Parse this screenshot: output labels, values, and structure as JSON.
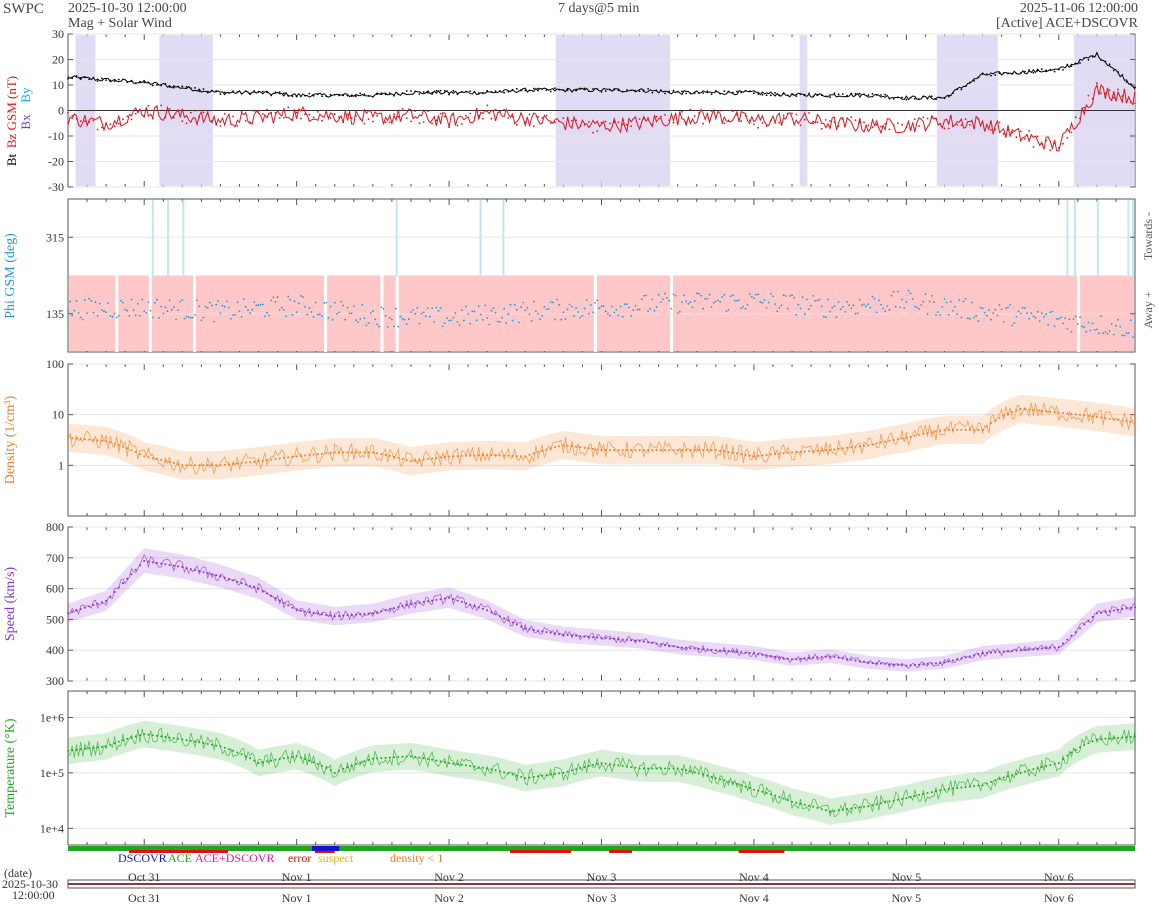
{
  "header": {
    "source": "SWPC",
    "start": "2025-10-30 12:00:00",
    "panel_title": "Mag + Solar Wind",
    "span": "7 days@5 min",
    "end": "2025-11-06 12:00:00",
    "spacecraft": "[Active] ACE+DSCOVR"
  },
  "colors": {
    "bt": "#000000",
    "bz": "#e0141e",
    "by": "#1ba6e4",
    "bx": "#7b35c9",
    "phi": "#1e9ad6",
    "density": "#f27c22",
    "speed": "#8a2fd0",
    "temperature": "#1fa81f",
    "south_shade": "#d9d2f0",
    "away_shade": "#ffc7c7",
    "dscovr": "#1414cc",
    "ace": "#1fa81f",
    "combined": "#e01ea0",
    "error": "#e01010",
    "suspect": "#f0b400",
    "low_density": "#f27c22"
  },
  "chart_data": [
    {
      "type": "line",
      "panel": "mag",
      "ylabel": {
        "bt": "Bt",
        "bz": "Bz GSM (nT)",
        "bx": "Bx",
        "by": "By"
      },
      "ylim": [
        -30,
        30
      ],
      "yticks": [
        "30",
        "20",
        "10",
        "0",
        "-10",
        "-20",
        "-30"
      ],
      "grid": true,
      "x_days": [
        0,
        0.25,
        0.5,
        0.75,
        1.0,
        1.25,
        1.5,
        1.75,
        2.0,
        2.25,
        2.5,
        2.75,
        3.0,
        3.25,
        3.5,
        3.75,
        4.0,
        4.25,
        4.5,
        4.75,
        5.0,
        5.25,
        5.5,
        5.75,
        6.0,
        6.25,
        6.5,
        6.75,
        7.0
      ],
      "series": [
        {
          "name": "Bt",
          "values": [
            13,
            12,
            11,
            9,
            7,
            7,
            6,
            6,
            6,
            7,
            7,
            7,
            8,
            8,
            8,
            8,
            7,
            7,
            7,
            6,
            6,
            6,
            5,
            5,
            14,
            15,
            16,
            22,
            9
          ]
        },
        {
          "name": "Bz",
          "values": [
            -3,
            -5,
            0,
            -2,
            -4,
            -3,
            -1,
            -2,
            -3,
            -2,
            -4,
            -1,
            -3,
            -5,
            -6,
            -5,
            -3,
            -2,
            -4,
            -3,
            -5,
            -6,
            -6,
            -4,
            -5,
            -10,
            -14,
            8,
            5
          ]
        }
      ],
      "southward_intervals": [
        [
          0.05,
          0.18
        ],
        [
          0.6,
          0.95
        ],
        [
          3.2,
          3.95
        ],
        [
          4.8,
          4.85
        ],
        [
          5.7,
          6.1
        ],
        [
          6.6,
          7.0
        ]
      ]
    },
    {
      "type": "scatter",
      "panel": "phi",
      "ylabel": "Phi GSM (deg)",
      "right_labels": [
        "Towards -",
        "Away +"
      ],
      "yticks": [
        "315",
        "135"
      ],
      "ylim": [
        45,
        405
      ],
      "grid": true,
      "x_days": [
        0,
        0.5,
        1.0,
        1.5,
        2.0,
        2.5,
        3.0,
        3.5,
        4.0,
        4.5,
        5.0,
        5.5,
        6.0,
        6.5,
        7.0
      ],
      "values": [
        145,
        150,
        140,
        155,
        130,
        125,
        140,
        150,
        160,
        165,
        150,
        165,
        140,
        120,
        100
      ]
    },
    {
      "type": "line",
      "panel": "density",
      "ylabel": "Density (1/cm³)",
      "yscale": "log",
      "ylim": [
        0.1,
        100
      ],
      "yticks": [
        "100",
        "10",
        "1"
      ],
      "grid": true,
      "x_days": [
        0,
        0.25,
        0.5,
        0.75,
        1.0,
        1.25,
        1.5,
        1.75,
        2.0,
        2.25,
        2.5,
        2.75,
        3.0,
        3.25,
        3.5,
        3.75,
        4.0,
        4.25,
        4.5,
        4.75,
        5.0,
        5.25,
        5.5,
        5.75,
        6.0,
        6.25,
        6.5,
        6.75,
        7.0
      ],
      "values": [
        3.5,
        3,
        1.5,
        1,
        1,
        1.2,
        1.5,
        1.8,
        1.8,
        1.2,
        1.5,
        1.6,
        1.5,
        2.5,
        2,
        2,
        2,
        2,
        1.5,
        1.8,
        2,
        2.5,
        3.5,
        5,
        5,
        13,
        11,
        9,
        7
      ]
    },
    {
      "type": "line",
      "panel": "speed",
      "ylabel": "Speed (km/s)",
      "ylim": [
        300,
        800
      ],
      "yticks": [
        "800",
        "700",
        "600",
        "500",
        "400",
        "300"
      ],
      "grid": true,
      "x_days": [
        0,
        0.25,
        0.5,
        0.75,
        1.0,
        1.25,
        1.5,
        1.75,
        2.0,
        2.25,
        2.5,
        2.75,
        3.0,
        3.25,
        3.5,
        3.75,
        4.0,
        4.25,
        4.5,
        4.75,
        5.0,
        5.25,
        5.5,
        5.75,
        6.0,
        6.25,
        6.5,
        6.75,
        7.0
      ],
      "values": [
        520,
        560,
        690,
        670,
        640,
        600,
        530,
        510,
        520,
        550,
        570,
        530,
        470,
        450,
        440,
        430,
        410,
        400,
        390,
        370,
        380,
        360,
        350,
        360,
        390,
        400,
        410,
        520,
        540
      ]
    },
    {
      "type": "line",
      "panel": "temperature",
      "ylabel": "Temperature (°K)",
      "yscale": "log",
      "ylim": [
        5000,
        3000000
      ],
      "yticks": [
        "1e+6",
        "1e+5",
        "1e+4"
      ],
      "grid": true,
      "x_days": [
        0,
        0.25,
        0.5,
        0.75,
        1.0,
        1.25,
        1.5,
        1.75,
        2.0,
        2.25,
        2.5,
        2.75,
        3.0,
        3.25,
        3.5,
        3.75,
        4.0,
        4.25,
        4.5,
        4.75,
        5.0,
        5.25,
        5.5,
        5.75,
        6.0,
        6.25,
        6.5,
        6.75,
        7.0
      ],
      "values": [
        250000,
        300000,
        500000,
        400000,
        300000,
        150000,
        200000,
        100000,
        180000,
        200000,
        150000,
        120000,
        80000,
        100000,
        150000,
        120000,
        120000,
        80000,
        50000,
        30000,
        20000,
        25000,
        35000,
        50000,
        60000,
        100000,
        150000,
        400000,
        450000
      ]
    }
  ],
  "legend": {
    "dscovr": "DSCOVR",
    "ace": "ACE",
    "combined": "ACE+DSCOVR",
    "error": "error",
    "suspect": "suspect",
    "low_density": "density < 1"
  },
  "xaxis": {
    "date_label": "(date)",
    "start_date": "2025-10-30",
    "start_time": "12:00:00",
    "ticks": [
      "Oct 31",
      "Nov 1",
      "Nov 2",
      "Nov 3",
      "Nov 4",
      "Nov 5",
      "Nov 6"
    ]
  }
}
